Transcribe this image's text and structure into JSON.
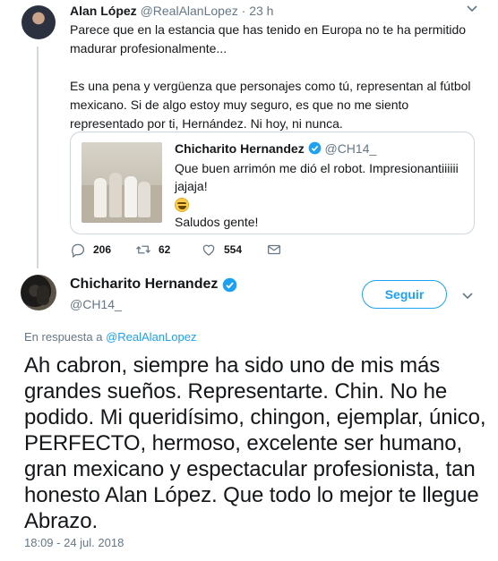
{
  "reply_tweet": {
    "author_name": "Alan López",
    "handle": "@RealAlanLopez",
    "separator": "·",
    "time": "23 h",
    "paragraphs": [
      "Parece que en la estancia que has tenido en Europa no te ha permitido madurar profesionalmente...",
      "Es una pena y vergüenza que personajes como tú, representan al fútbol mexicano. Si de algo estoy muy seguro, es que no me siento representado por ti, Hernández. Ni hoy, ni nunca."
    ],
    "quoted": {
      "author_name": "Chicharito Hernandez",
      "handle": "@CH14_",
      "text": "Que buen arrimón me dió el robot. Impresionantiiiiii jajaja!",
      "emoji": "rolling-on-floor-laughing-emoji",
      "text2": "Saludos gente!"
    },
    "actions": {
      "replies": "206",
      "retweets": "62",
      "likes": "554"
    }
  },
  "main_tweet": {
    "author_name": "Chicharito Hernandez",
    "handle": "@CH14_",
    "follow_label": "Seguir",
    "reply_prefix": "En respuesta a",
    "reply_handle": "@RealAlanLopez",
    "text": "Ah cabron, siempre ha sido uno de mis más grandes sueños. Representarte. Chin. No he podido. Mi queridísimo, chingon, ejemplar, único, PERFECTO, hermoso, excelente ser humano, gran mexicano y espectacular profesionista, tan honesto Alan López. Que todo lo mejor te llegue Abrazo.",
    "timestamp": "18:09 - 24 jul. 2018"
  },
  "colors": {
    "accent": "#1da1f2",
    "secondary_text": "#657786",
    "verified": "#1da1f2"
  }
}
